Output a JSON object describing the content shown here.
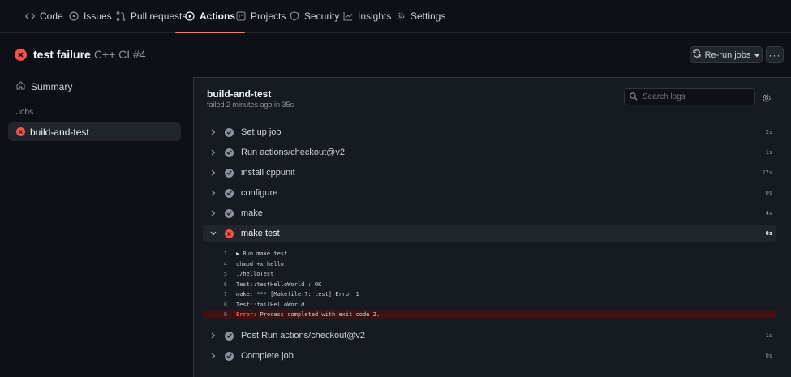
{
  "nav": {
    "tabs": [
      {
        "label": "Code",
        "icon": "code-icon"
      },
      {
        "label": "Issues",
        "icon": "issue-icon"
      },
      {
        "label": "Pull requests",
        "icon": "pull-request-icon"
      },
      {
        "label": "Actions",
        "icon": "play-icon",
        "active": true
      },
      {
        "label": "Projects",
        "icon": "project-icon"
      },
      {
        "label": "Security",
        "icon": "shield-icon"
      },
      {
        "label": "Insights",
        "icon": "graph-icon"
      },
      {
        "label": "Settings",
        "icon": "gear-icon"
      }
    ]
  },
  "header": {
    "title": "test failure",
    "subtitle": "C++ CI #4",
    "rerun_label": "Re-run jobs",
    "more_label": "···"
  },
  "sidebar": {
    "summary_label": "Summary",
    "jobs_heading": "Jobs",
    "job_label": "build-and-test"
  },
  "job": {
    "title": "build-and-test",
    "meta": "failed 2 minutes ago in 35s",
    "search_placeholder": "Search logs"
  },
  "steps": [
    {
      "name": "Set up job",
      "duration": "2s",
      "status": "success"
    },
    {
      "name": "Run actions/checkout@v2",
      "duration": "1s",
      "status": "success"
    },
    {
      "name": "install cppunit",
      "duration": "27s",
      "status": "success"
    },
    {
      "name": "configure",
      "duration": "0s",
      "status": "success"
    },
    {
      "name": "make",
      "duration": "4s",
      "status": "success"
    },
    {
      "name": "make test",
      "duration": "0s",
      "status": "failure",
      "expanded": true
    },
    {
      "name": "Post Run actions/checkout@v2",
      "duration": "1s",
      "status": "success"
    },
    {
      "name": "Complete job",
      "duration": "0s",
      "status": "success"
    }
  ],
  "log": [
    {
      "num": "1",
      "text": "▶ Run make test"
    },
    {
      "num": "4",
      "text": "chmod +x hello"
    },
    {
      "num": "5",
      "text": "./helloTest"
    },
    {
      "num": "6",
      "text": "Test::testHelloWorld : OK"
    },
    {
      "num": "7",
      "text": "make: *** [Makefile:7: test] Error 1"
    },
    {
      "num": "8",
      "text": "Test::failHelloWorld"
    },
    {
      "num": "9",
      "error_label": "Error:",
      "text": " Process completed with exit code 2.",
      "error": true
    }
  ],
  "colors": {
    "background": "#0d1117",
    "panel": "#161b22",
    "failure": "#f85149",
    "success": "#8b949e",
    "active_tab_underline": "#f78166"
  }
}
